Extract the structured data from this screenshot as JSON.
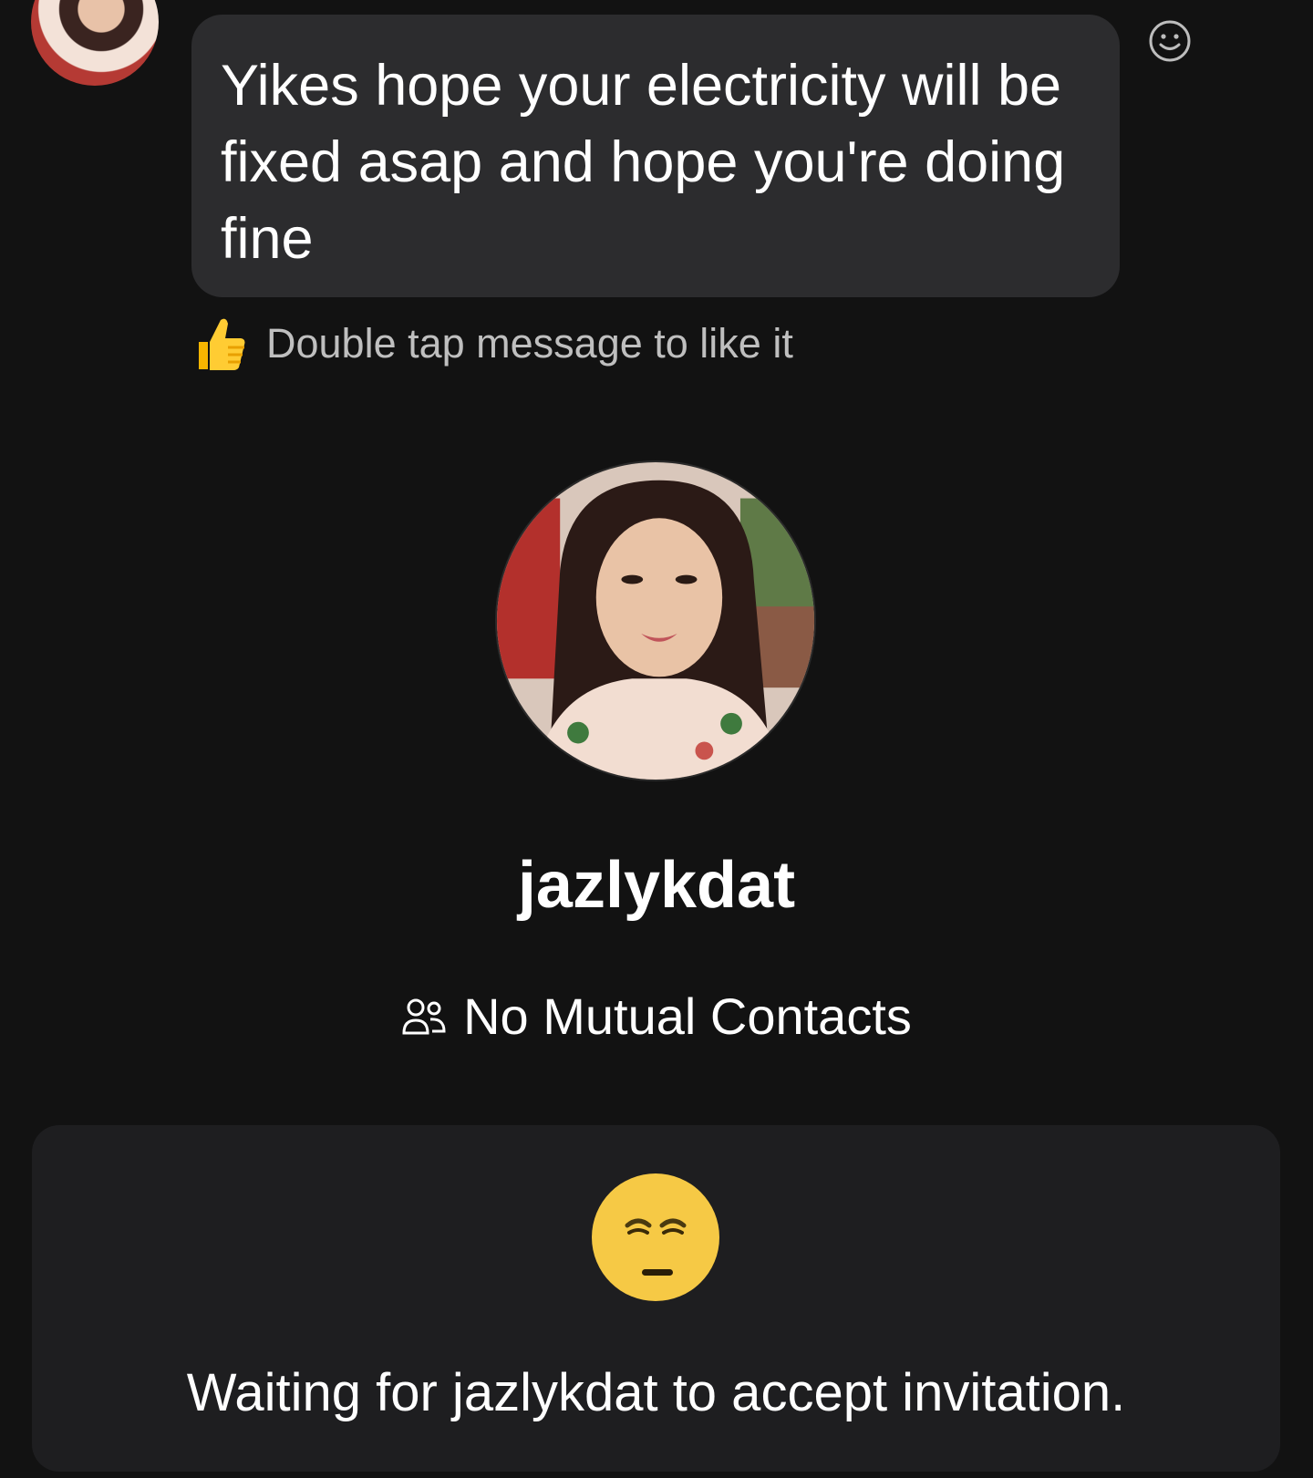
{
  "message": {
    "sender_name": "jazlykdat",
    "text": "Yikes hope your electricity will be fixed asap and hope you're doing fine"
  },
  "hint": {
    "text": "Double tap message to like it",
    "icon": "thumbs-up-icon"
  },
  "profile": {
    "username": "jazlykdat",
    "mutual_contacts": "No Mutual Contacts"
  },
  "invite": {
    "status_text": "Waiting for jazlykdat to accept invitation.",
    "icon": "relieved-face-icon"
  },
  "colors": {
    "background": "#121212",
    "bubble": "#2c2c2e",
    "card": "#1e1e20",
    "hint_text": "#bfbfbf"
  }
}
